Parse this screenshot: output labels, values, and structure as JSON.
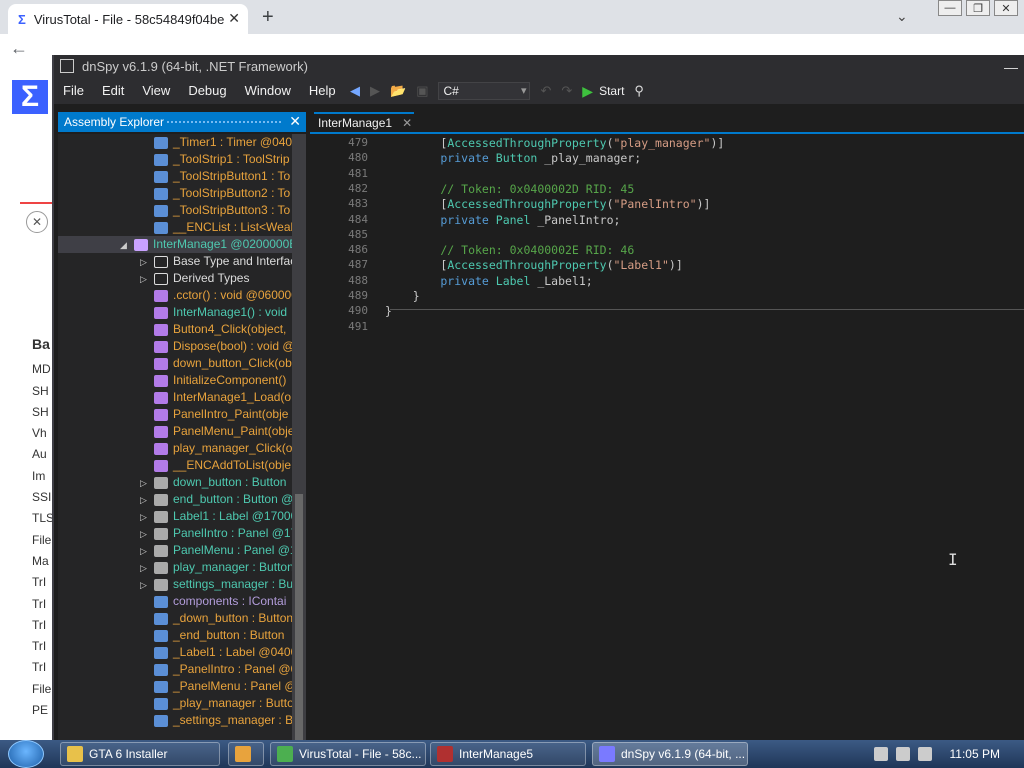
{
  "browser": {
    "tab_title": "VirusTotal - File - 58c54849f04be",
    "new_tab": "+",
    "vt_side_labels": [
      "Ba",
      "MD",
      "SH",
      "SH",
      "Vh",
      "Au",
      "Im",
      "SSI",
      "TLS",
      "File",
      "Ma",
      "TrI",
      "TrI",
      "TrI",
      "TrI",
      "TrI",
      "File",
      "PE"
    ]
  },
  "dnspy": {
    "title": "dnSpy v6.1.9 (64-bit, .NET Framework)",
    "menu": [
      "File",
      "Edit",
      "View",
      "Debug",
      "Window",
      "Help"
    ],
    "language": "C#",
    "start_label": "Start",
    "assembly_explorer_title": "Assembly Explorer",
    "editor_tab": "InterManage1",
    "tree": [
      {
        "text": "_Timer1 : Timer @0400",
        "kind": "field-private",
        "color": "#e8a33d",
        "expand": ""
      },
      {
        "text": "_ToolStrip1 : ToolStrip",
        "kind": "field-private",
        "color": "#e8a33d",
        "expand": ""
      },
      {
        "text": "_ToolStripButton1 : To",
        "kind": "field-private",
        "color": "#e8a33d",
        "expand": ""
      },
      {
        "text": "_ToolStripButton2 : To",
        "kind": "field-private",
        "color": "#e8a33d",
        "expand": ""
      },
      {
        "text": "_ToolStripButton3 : To",
        "kind": "field-private",
        "color": "#e8a33d",
        "expand": ""
      },
      {
        "text": "__ENCList : List<Weak",
        "kind": "field-private",
        "color": "#e8a33d",
        "expand": ""
      },
      {
        "text": "InterManage1 @0200000E",
        "kind": "class",
        "color": "#4ec9b0",
        "expand": "◢",
        "selected": true
      },
      {
        "text": "Base Type and Interfac",
        "kind": "folder",
        "color": "#dcdcdc",
        "expand": "▷"
      },
      {
        "text": "Derived Types",
        "kind": "folder",
        "color": "#dcdcdc",
        "expand": "▷"
      },
      {
        "text": ".cctor() : void @060000",
        "kind": "method",
        "color": "#e8a33d",
        "expand": ""
      },
      {
        "text": "InterManage1() : void",
        "kind": "method",
        "color": "#4ec9b0",
        "expand": ""
      },
      {
        "text": "Button4_Click(object,",
        "kind": "method",
        "color": "#e8a33d",
        "expand": ""
      },
      {
        "text": "Dispose(bool) : void @",
        "kind": "method",
        "color": "#e8a33d",
        "expand": ""
      },
      {
        "text": "down_button_Click(ob",
        "kind": "method",
        "color": "#e8a33d",
        "expand": ""
      },
      {
        "text": "InitializeComponent()",
        "kind": "method",
        "color": "#e8a33d",
        "expand": ""
      },
      {
        "text": "InterManage1_Load(o",
        "kind": "method",
        "color": "#e8a33d",
        "expand": ""
      },
      {
        "text": "PanelIntro_Paint(obje",
        "kind": "method",
        "color": "#e8a33d",
        "expand": ""
      },
      {
        "text": "PanelMenu_Paint(obje",
        "kind": "method",
        "color": "#e8a33d",
        "expand": ""
      },
      {
        "text": "play_manager_Click(o",
        "kind": "method",
        "color": "#e8a33d",
        "expand": ""
      },
      {
        "text": "__ENCAddToList(obje",
        "kind": "method",
        "color": "#e8a33d",
        "expand": ""
      },
      {
        "text": "down_button : Button",
        "kind": "property",
        "color": "#4ec9b0",
        "expand": "▷"
      },
      {
        "text": "end_button : Button @",
        "kind": "property",
        "color": "#4ec9b0",
        "expand": "▷"
      },
      {
        "text": "Label1 : Label @17000",
        "kind": "property",
        "color": "#4ec9b0",
        "expand": "▷"
      },
      {
        "text": "PanelIntro : Panel @17",
        "kind": "property",
        "color": "#4ec9b0",
        "expand": "▷"
      },
      {
        "text": "PanelMenu : Panel @1",
        "kind": "property",
        "color": "#4ec9b0",
        "expand": "▷"
      },
      {
        "text": "play_manager : Button",
        "kind": "property",
        "color": "#4ec9b0",
        "expand": "▷"
      },
      {
        "text": "settings_manager : Bu",
        "kind": "property",
        "color": "#4ec9b0",
        "expand": "▷"
      },
      {
        "text": "components : IContai",
        "kind": "field-private",
        "color": "#b39ddb",
        "expand": ""
      },
      {
        "text": "_down_button : Button",
        "kind": "field-private",
        "color": "#e8a33d",
        "expand": ""
      },
      {
        "text": "_end_button : Button",
        "kind": "field-private",
        "color": "#e8a33d",
        "expand": ""
      },
      {
        "text": "_Label1 : Label @04000",
        "kind": "field-private",
        "color": "#e8a33d",
        "expand": ""
      },
      {
        "text": "_PanelIntro : Panel @0",
        "kind": "field-private",
        "color": "#e8a33d",
        "expand": ""
      },
      {
        "text": "_PanelMenu : Panel @",
        "kind": "field-private",
        "color": "#e8a33d",
        "expand": ""
      },
      {
        "text": "_play_manager : Butto",
        "kind": "field-private",
        "color": "#e8a33d",
        "expand": ""
      },
      {
        "text": "_settings_manager : Bu",
        "kind": "field-private",
        "color": "#e8a33d",
        "expand": ""
      }
    ],
    "code": [
      {
        "ln": "479",
        "parts": [
          [
            "pr",
            "        ["
          ],
          [
            "ty",
            "AccessedThroughProperty"
          ],
          [
            "pr",
            "("
          ],
          [
            "st",
            "\"play_manager\""
          ],
          [
            "pr",
            ")]"
          ]
        ]
      },
      {
        "ln": "480",
        "parts": [
          [
            "kw",
            "        private "
          ],
          [
            "ty",
            "Button"
          ],
          [
            "pr",
            " _play_manager;"
          ]
        ]
      },
      {
        "ln": "481",
        "parts": []
      },
      {
        "ln": "482",
        "parts": [
          [
            "cm",
            "        // Token: 0x0400002D RID: 45"
          ]
        ]
      },
      {
        "ln": "483",
        "parts": [
          [
            "pr",
            "        ["
          ],
          [
            "ty",
            "AccessedThroughProperty"
          ],
          [
            "pr",
            "("
          ],
          [
            "st",
            "\"PanelIntro\""
          ],
          [
            "pr",
            ")]"
          ]
        ]
      },
      {
        "ln": "484",
        "parts": [
          [
            "kw",
            "        private "
          ],
          [
            "ty",
            "Panel"
          ],
          [
            "pr",
            " _PanelIntro;"
          ]
        ]
      },
      {
        "ln": "485",
        "parts": []
      },
      {
        "ln": "486",
        "parts": [
          [
            "cm",
            "        // Token: 0x0400002E RID: 46"
          ]
        ]
      },
      {
        "ln": "487",
        "parts": [
          [
            "pr",
            "        ["
          ],
          [
            "ty",
            "AccessedThroughProperty"
          ],
          [
            "pr",
            "("
          ],
          [
            "st",
            "\"Label1\""
          ],
          [
            "pr",
            ")]"
          ]
        ]
      },
      {
        "ln": "488",
        "parts": [
          [
            "kw",
            "        private "
          ],
          [
            "ty",
            "Label"
          ],
          [
            "pr",
            " _Label1;"
          ]
        ]
      },
      {
        "ln": "489",
        "parts": [
          [
            "pr",
            "    }"
          ]
        ]
      },
      {
        "ln": "490",
        "parts": [
          [
            "pr",
            "}"
          ]
        ]
      },
      {
        "ln": "491",
        "parts": []
      }
    ]
  },
  "taskbar": {
    "items": [
      {
        "label": "GTA 6 Installer",
        "icon_color": "#e8c14a"
      },
      {
        "label": "",
        "icon_color": "#e8a33d"
      },
      {
        "label": "VirusTotal - File - 58c...",
        "icon_color": "#4caf50"
      },
      {
        "label": "InterManage5",
        "icon_color": "#b03030"
      },
      {
        "label": "dnSpy v6.1.9 (64-bit, ...",
        "icon_color": "#7a7aff"
      }
    ],
    "clock": "11:05 PM"
  },
  "colors": {
    "accent": "#007acc",
    "vt_brand": "#3b61ff"
  }
}
